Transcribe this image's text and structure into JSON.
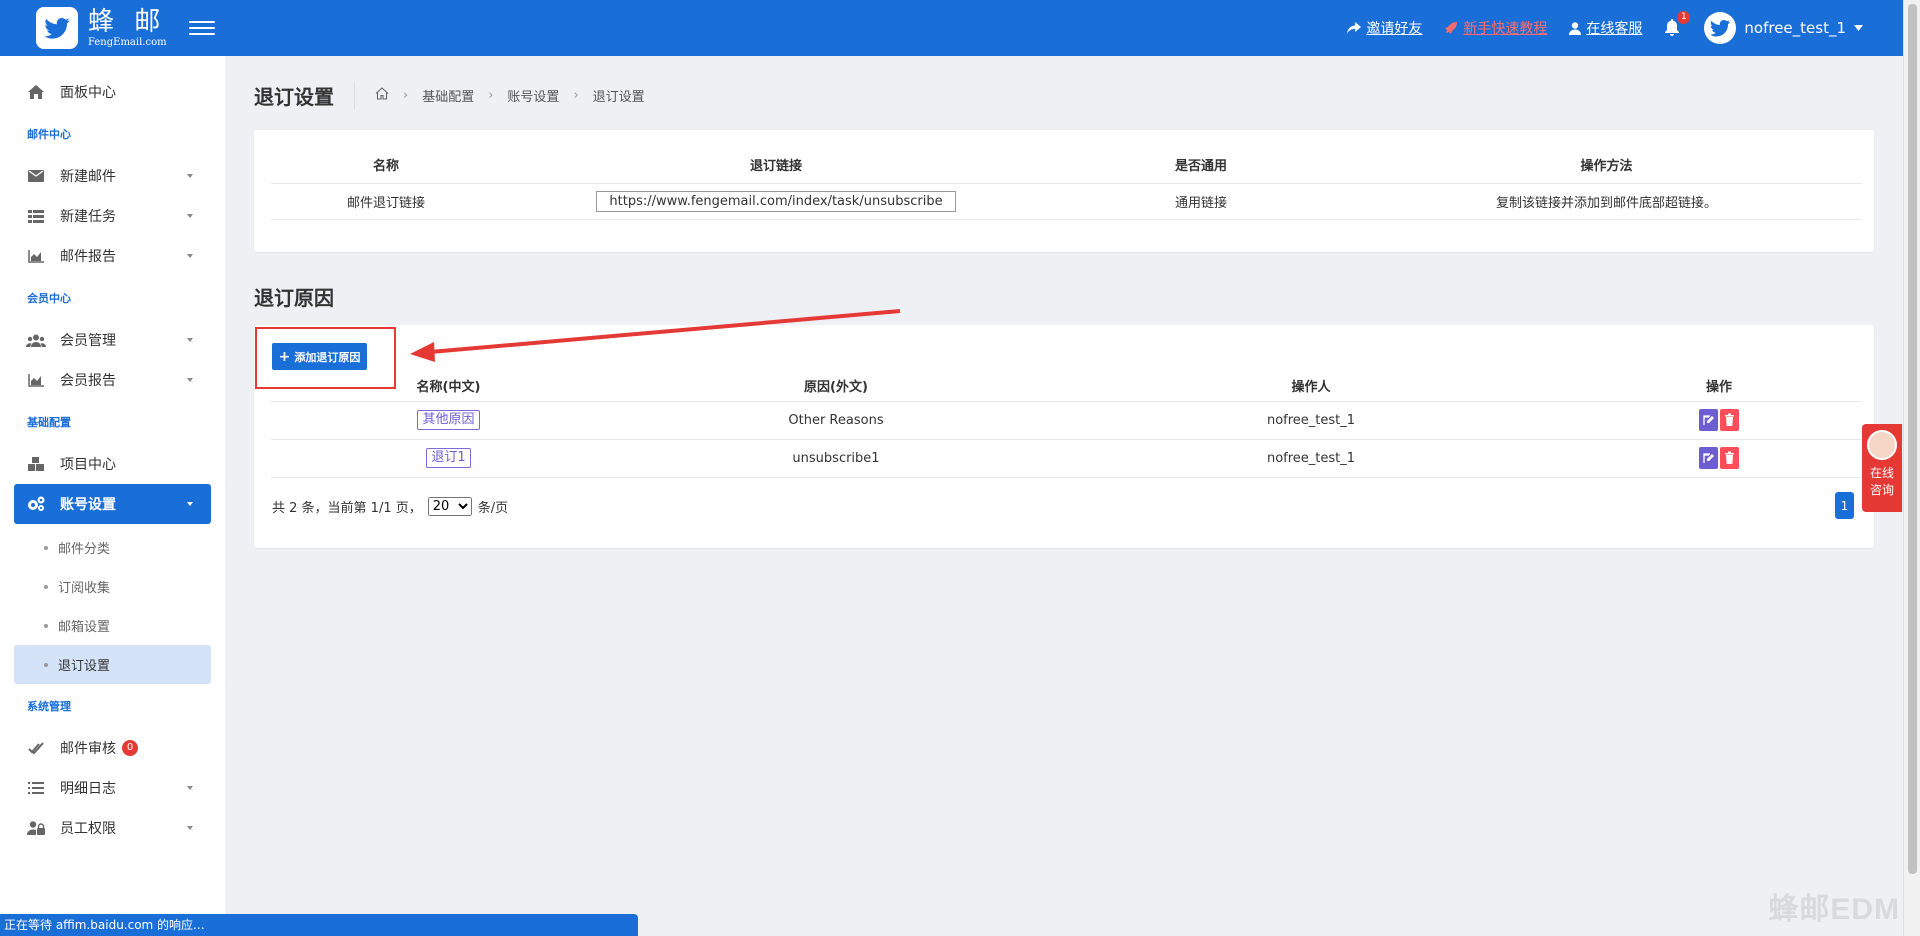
{
  "topbar": {
    "logo_cn": "蜂 邮",
    "logo_en": "FengEmail.com",
    "invite": "邀请好友",
    "tutorial": "新手快速教程",
    "support": "在线客服",
    "notify_count": "1",
    "username": "nofree_test_1"
  },
  "sidebar": {
    "dashboard": "面板中心",
    "section_mail": "邮件中心",
    "new_mail": "新建邮件",
    "new_task": "新建任务",
    "mail_report": "邮件报告",
    "section_member": "会员中心",
    "member_manage": "会员管理",
    "member_report": "会员报告",
    "section_base": "基础配置",
    "project_center": "项目中心",
    "account_settings": "账号设置",
    "sub_mail_category": "邮件分类",
    "sub_subscribe_collect": "订阅收集",
    "sub_mailbox_settings": "邮箱设置",
    "sub_unsubscribe_settings": "退订设置",
    "section_system": "系统管理",
    "mail_review": "邮件审核",
    "mail_review_count": "0",
    "detail_log": "明细日志",
    "staff_permission": "员工权限"
  },
  "page": {
    "title": "退订设置",
    "breadcrumb": [
      "基础配置",
      "账号设置",
      "退订设置"
    ]
  },
  "link_table": {
    "headers": [
      "名称",
      "退订链接",
      "是否通用",
      "操作方法"
    ],
    "row": {
      "name": "邮件退订链接",
      "url": "https://www.fengemail.com/index/task/unsubscribe",
      "common": "通用链接",
      "method": "复制该链接并添加到邮件底部超链接。"
    }
  },
  "reason_section": {
    "title": "退订原因",
    "add_button": "添加退订原因",
    "headers": [
      "名称(中文)",
      "原因(外文)",
      "操作人",
      "操作"
    ],
    "rows": [
      {
        "name_cn": "其他原因",
        "reason_en": "Other Reasons",
        "operator": "nofree_test_1"
      },
      {
        "name_cn": "退订1",
        "reason_en": "unsubscribe1",
        "operator": "nofree_test_1"
      }
    ],
    "pager_prefix": "共 2 条，当前第 1/1 页，",
    "page_size": "20",
    "pager_suffix": "条/页",
    "current_page": "1"
  },
  "consult": {
    "line1": "在线",
    "line2": "咨询"
  },
  "status_bar": "正在等待 affim.baidu.com 的响应...",
  "watermark": "蜂邮EDM"
}
